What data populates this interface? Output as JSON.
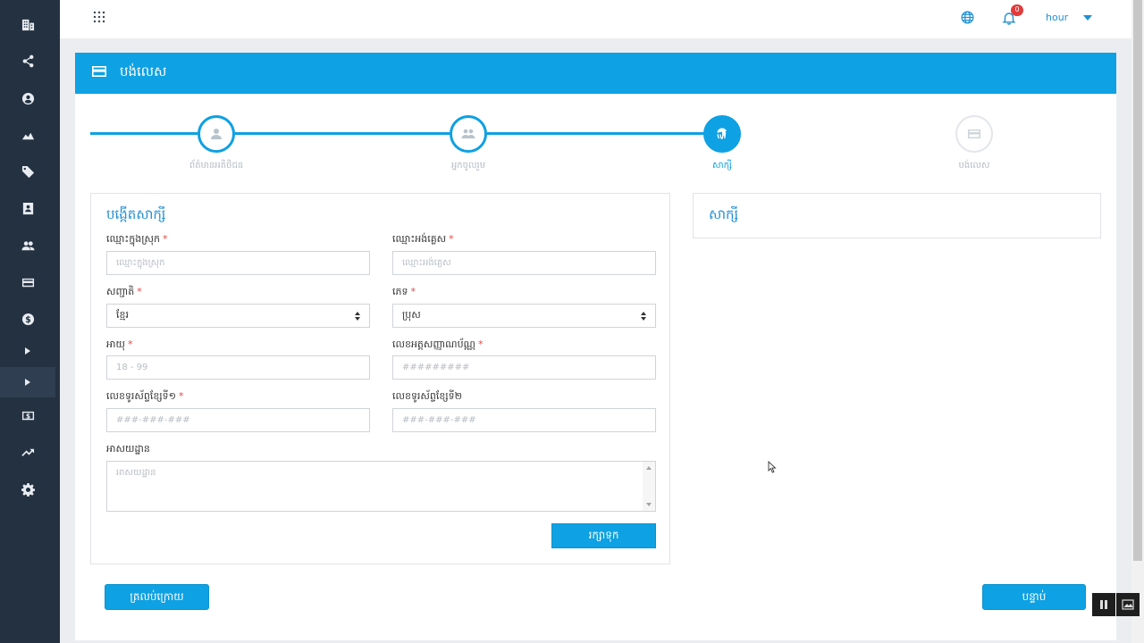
{
  "sidebar": {
    "items": [
      {
        "icon": "building-icon"
      },
      {
        "icon": "share-icon"
      },
      {
        "icon": "user-circle-icon"
      },
      {
        "icon": "area-chart-icon"
      },
      {
        "icon": "tag-icon"
      },
      {
        "icon": "contact-book-icon"
      },
      {
        "icon": "users-icon"
      },
      {
        "icon": "credit-card-icon"
      },
      {
        "icon": "dollar-circle-icon"
      },
      {
        "icon": "caret-right-icon"
      },
      {
        "icon": "caret-right-icon",
        "active": true
      },
      {
        "icon": "money-icon"
      },
      {
        "icon": "trending-up-icon"
      },
      {
        "icon": "gear-icon"
      }
    ]
  },
  "topbar": {
    "notification_count": "0",
    "user_name": "hour"
  },
  "panel": {
    "title": "បង់លេស"
  },
  "stepper": {
    "steps": [
      {
        "label": "ព័ត៌មានអតិថិជន",
        "icon": "user-icon",
        "state": "done"
      },
      {
        "label": "អ្នកចូលរួម",
        "icon": "group-icon",
        "state": "done"
      },
      {
        "label": "សាក្សី",
        "icon": "fingerprint-icon",
        "state": "active"
      },
      {
        "label": "បង់លេស",
        "icon": "credit-card-icon",
        "state": "pending"
      }
    ]
  },
  "form": {
    "title": "បង្កើតសាក្សី",
    "khmer_name": {
      "label": "ឈ្មោះក្នុងស្រុក",
      "required": "*",
      "placeholder": "ឈ្មោះក្នុងស្រុក"
    },
    "english_name": {
      "label": "ឈ្មោះអង់គ្លេស",
      "required": "*",
      "placeholder": "ឈ្មោះអង់គ្លេស"
    },
    "nationality": {
      "label": "សញ្ជាតិ",
      "required": "*",
      "value": "ខ្មែរ"
    },
    "gender": {
      "label": "ភេទ",
      "required": "*",
      "value": "ប្រុស"
    },
    "age": {
      "label": "អាយុ",
      "required": "*",
      "placeholder": "18 - 99"
    },
    "id_card": {
      "label": "លេខអត្តសញ្ញាណប័ណ្ណ",
      "required": "*",
      "placeholder": "#########"
    },
    "phone1": {
      "label": "លេខទូរស័ព្ទខ្សែទី១",
      "required": "*",
      "placeholder": "###-###-###"
    },
    "phone2": {
      "label": "លេខទូរស័ព្ទខ្សែទី២",
      "placeholder": "###-###-###"
    },
    "address": {
      "label": "អាសយដ្ឋាន",
      "placeholder": "អាសយដ្ឋាន"
    },
    "save_label": "រក្សាទុក"
  },
  "witness_card": {
    "title": "សាក្សី"
  },
  "footer": {
    "back_label": "ត្រលប់ក្រោយ",
    "next_label": "បន្ទាប់"
  },
  "colors": {
    "accent": "#0ea1e3",
    "sidebar": "#233141",
    "required": "#e04848"
  }
}
